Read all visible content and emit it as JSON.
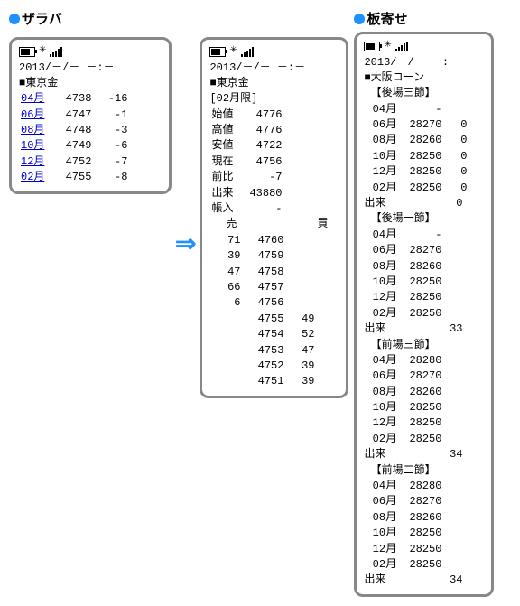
{
  "zaraba": {
    "heading": "ザラバ",
    "timestamp": "2013/－/－  －:－",
    "market": "■東京金",
    "rows": [
      {
        "month": "04月",
        "price": "4738",
        "chg": "-16"
      },
      {
        "month": "06月",
        "price": "4747",
        "chg": "-1"
      },
      {
        "month": "08月",
        "price": "4748",
        "chg": "-3"
      },
      {
        "month": "10月",
        "price": "4749",
        "chg": "-6"
      },
      {
        "month": "12月",
        "price": "4752",
        "chg": "-7"
      },
      {
        "month": "02月",
        "price": "4755",
        "chg": "-8"
      }
    ]
  },
  "detail": {
    "timestamp": "2013/－/－  －:－",
    "market": "■東京金",
    "contract": "[02月限]",
    "ohlc": [
      {
        "label": "始値",
        "val": "4776"
      },
      {
        "label": "高値",
        "val": "4776"
      },
      {
        "label": "安値",
        "val": "4722"
      },
      {
        "label": "現在",
        "val": "4756"
      },
      {
        "label": "前比",
        "val": "-7"
      },
      {
        "label": "出来",
        "val": "43880"
      },
      {
        "label": "帳入",
        "val": "-"
      }
    ],
    "book_hdr_sell": "売",
    "book_hdr_buy": "買",
    "book": [
      {
        "sell": "71",
        "price": "4760",
        "buy": ""
      },
      {
        "sell": "39",
        "price": "4759",
        "buy": ""
      },
      {
        "sell": "47",
        "price": "4758",
        "buy": ""
      },
      {
        "sell": "66",
        "price": "4757",
        "buy": ""
      },
      {
        "sell": "6",
        "price": "4756",
        "buy": ""
      },
      {
        "sell": "",
        "price": "4755",
        "buy": "49"
      },
      {
        "sell": "",
        "price": "4754",
        "buy": "52"
      },
      {
        "sell": "",
        "price": "4753",
        "buy": "47"
      },
      {
        "sell": "",
        "price": "4752",
        "buy": "39"
      },
      {
        "sell": "",
        "price": "4751",
        "buy": "39"
      }
    ]
  },
  "itayose": {
    "heading": "板寄せ",
    "timestamp": "2013/－/－  －:－",
    "market": "■大阪コーン",
    "sections": [
      {
        "label": "【後場三節】",
        "rows": [
          {
            "m": "04月",
            "p": "-",
            "c": ""
          },
          {
            "m": "06月",
            "p": "28270",
            "c": "0"
          },
          {
            "m": "08月",
            "p": "28260",
            "c": "0"
          },
          {
            "m": "10月",
            "p": "28250",
            "c": "0"
          },
          {
            "m": "12月",
            "p": "28250",
            "c": "0"
          },
          {
            "m": "02月",
            "p": "28250",
            "c": "0"
          }
        ],
        "vol_label": "出来",
        "vol": "0"
      },
      {
        "label": "【後場一節】",
        "rows": [
          {
            "m": "04月",
            "p": "-",
            "c": ""
          },
          {
            "m": "06月",
            "p": "28270",
            "c": ""
          },
          {
            "m": "08月",
            "p": "28260",
            "c": ""
          },
          {
            "m": "10月",
            "p": "28250",
            "c": ""
          },
          {
            "m": "12月",
            "p": "28250",
            "c": ""
          },
          {
            "m": "02月",
            "p": "28250",
            "c": ""
          }
        ],
        "vol_label": "出来",
        "vol": "33"
      },
      {
        "label": "【前場三節】",
        "rows": [
          {
            "m": "04月",
            "p": "28280",
            "c": ""
          },
          {
            "m": "06月",
            "p": "28270",
            "c": ""
          },
          {
            "m": "08月",
            "p": "28260",
            "c": ""
          },
          {
            "m": "10月",
            "p": "28250",
            "c": ""
          },
          {
            "m": "12月",
            "p": "28250",
            "c": ""
          },
          {
            "m": "02月",
            "p": "28250",
            "c": ""
          }
        ],
        "vol_label": "出来",
        "vol": "34"
      },
      {
        "label": "【前場二節】",
        "rows": [
          {
            "m": "04月",
            "p": "28280",
            "c": ""
          },
          {
            "m": "06月",
            "p": "28270",
            "c": ""
          },
          {
            "m": "08月",
            "p": "28260",
            "c": ""
          },
          {
            "m": "10月",
            "p": "28250",
            "c": ""
          },
          {
            "m": "12月",
            "p": "28250",
            "c": ""
          },
          {
            "m": "02月",
            "p": "28250",
            "c": ""
          }
        ],
        "vol_label": "出来",
        "vol": "34"
      }
    ]
  }
}
